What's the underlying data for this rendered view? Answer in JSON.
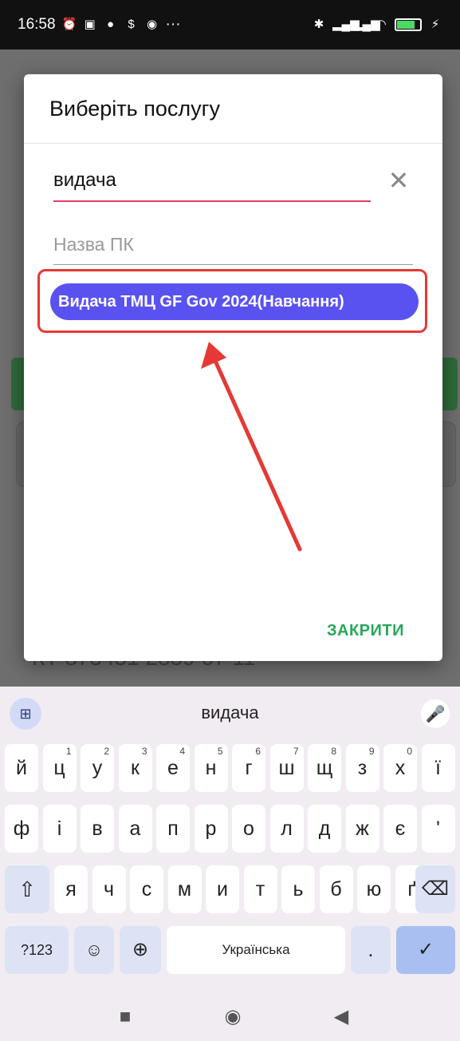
{
  "status_bar": {
    "time": "16:58",
    "left_icons": [
      "alarm-icon",
      "nfc-icon",
      "skype-icon",
      "s-icon",
      "notification-icon"
    ],
    "more": "···",
    "right_icons": [
      "bluetooth-icon",
      "signal-icon",
      "signal-icon",
      "wifi-icon"
    ],
    "battery_level": "78",
    "battery_color": "#4cd964"
  },
  "background": {
    "partial_input": "КТ 873431 2839 07 11"
  },
  "dialog": {
    "title": "Виберіть послугу",
    "search_value": "видача",
    "pk_placeholder": "Назва ПК",
    "results": [
      {
        "label": "Видача ТМЦ GF Gov 2024(Навчання)"
      }
    ],
    "close_label": "ЗАКРИТИ",
    "result_color": "#5a52f0",
    "close_color": "#27a85a",
    "highlight_color": "#e53935"
  },
  "keyboard": {
    "suggestion": "видача",
    "language": "Українська",
    "row1": [
      {
        "k": "й",
        "h": ""
      },
      {
        "k": "ц",
        "h": "1"
      },
      {
        "k": "у",
        "h": "2"
      },
      {
        "k": "к",
        "h": "3"
      },
      {
        "k": "е",
        "h": "4"
      },
      {
        "k": "н",
        "h": "5"
      },
      {
        "k": "г",
        "h": "6"
      },
      {
        "k": "ш",
        "h": "7"
      },
      {
        "k": "щ",
        "h": "8"
      },
      {
        "k": "з",
        "h": "9"
      },
      {
        "k": "х",
        "h": "0"
      },
      {
        "k": "ї",
        "h": ""
      }
    ],
    "row2": [
      "ф",
      "і",
      "в",
      "а",
      "п",
      "р",
      "о",
      "л",
      "д",
      "ж",
      "є",
      "'"
    ],
    "row3": [
      "я",
      "ч",
      "с",
      "м",
      "и",
      "т",
      "ь",
      "б",
      "ю",
      "ґ"
    ],
    "symbols_label": "?123",
    "period_label": ".",
    "emoji_label": "☺"
  }
}
